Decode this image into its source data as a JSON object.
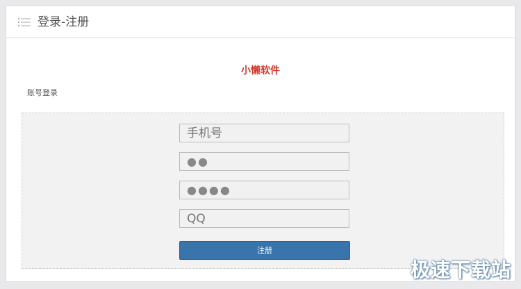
{
  "header": {
    "title": "登录-注册",
    "icon": "list-icon"
  },
  "brand": {
    "name": "小懒软件",
    "color": "#d33a2e"
  },
  "section": {
    "label": "账号登录"
  },
  "form": {
    "phone": {
      "placeholder": "手机号",
      "value": ""
    },
    "password": {
      "masked": "●●"
    },
    "confirm_password": {
      "masked": "●●●●"
    },
    "qq": {
      "placeholder": "QQ",
      "value": ""
    },
    "submit_label": "注册",
    "accent": "#3a74ac"
  },
  "watermark": {
    "text": "极速下载站"
  }
}
